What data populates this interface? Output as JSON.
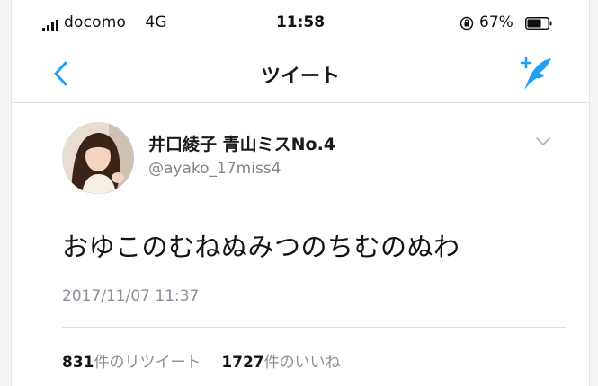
{
  "status_bar": {
    "carrier": "docomo",
    "network": "4G",
    "time": "11:58",
    "battery_percent": "67%",
    "battery_level": 0.67,
    "icons": [
      "signal-icon",
      "orientation-lock-icon",
      "battery-icon"
    ]
  },
  "nav": {
    "title": "ツイート",
    "back_icon": "chevron-left-icon",
    "compose_icon": "compose-tweet-icon",
    "accent_color": "#1da1f2"
  },
  "tweet": {
    "display_name": "井口綾子 青山ミスNo.4",
    "handle": "@ayako_17miss4",
    "text": "おゆこのむねぬみつのちむのぬわ",
    "timestamp": "2017/11/07 11:37",
    "retweet_count": "831",
    "retweet_label": "件のリツイート",
    "like_count": "1727",
    "like_label": "件のいいね"
  }
}
